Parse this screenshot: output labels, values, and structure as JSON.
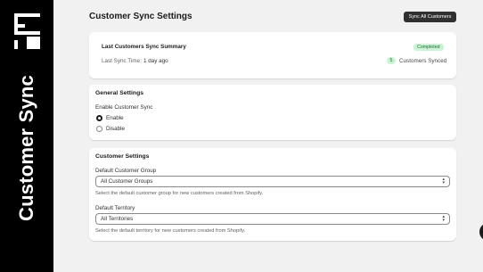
{
  "sidebar": {
    "title": "Customer Sync"
  },
  "header": {
    "title": "Customer Sync Settings",
    "sync_button": "Sync All Customers"
  },
  "summary": {
    "title": "Last Customers Sync Summary",
    "status": "Completed",
    "last_sync_label": "Last Sync Time:",
    "last_sync_value": "1 day ago",
    "count": "5",
    "count_label": "Customers Synced"
  },
  "general": {
    "title": "General Settings",
    "enable_label": "Enable Customer Sync",
    "options": [
      "Enable",
      "Disable"
    ],
    "selected": "Enable"
  },
  "customer_settings": {
    "title": "Customer Settings",
    "group_label": "Default Customer Group",
    "group_value": "All Customer Groups",
    "group_help": "Select the default customer group for new customers created from Shopify.",
    "territory_label": "Default Territory",
    "territory_value": "All Territories",
    "territory_help": "Select the default territory for new customers created from Shopify."
  },
  "colors": {
    "sidebar": "#000000",
    "badge_bg": "#cdf3d6",
    "badge_text": "#1f6b38",
    "button": "#303030"
  }
}
